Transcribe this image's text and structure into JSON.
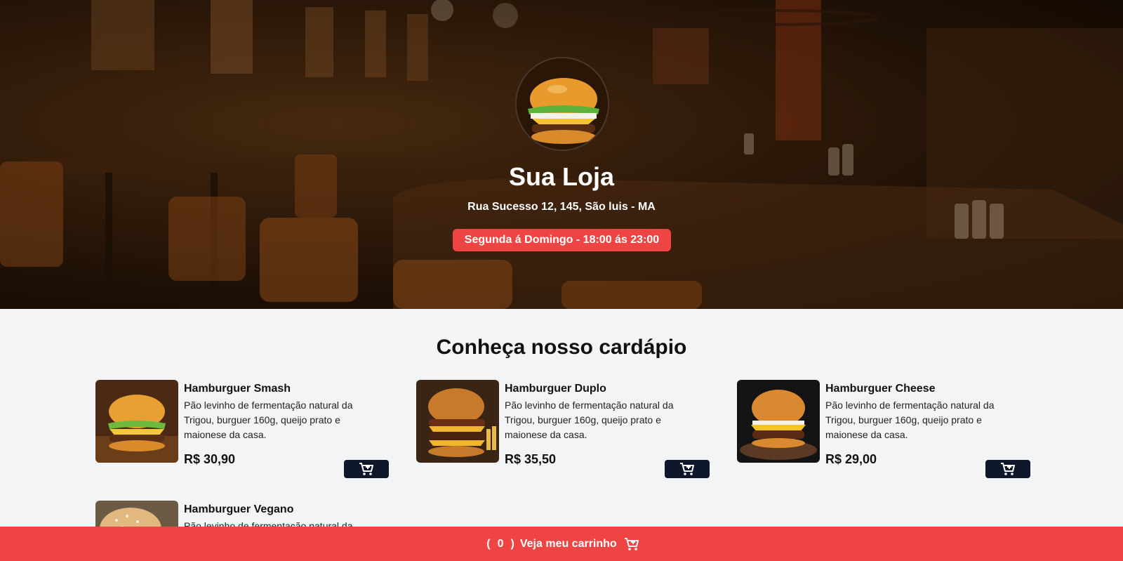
{
  "hero": {
    "store_name": "Sua Loja",
    "address": "Rua Sucesso 12, 145, São luis - MA",
    "hours": "Segunda á Domingo - 18:00 ás 23:00",
    "logo_icon": "burger-logo-icon"
  },
  "menu": {
    "title": "Conheça nosso cardápio",
    "products": [
      {
        "name": "Hamburguer Smash",
        "description": "Pão levinho de fermentação natural da Trigou, burguer 160g, queijo prato e maionese da casa.",
        "price": "R$ 30,90",
        "icon": "burger-smash-image"
      },
      {
        "name": "Hamburguer Duplo",
        "description": "Pão levinho de fermentação natural da Trigou, burguer 160g, queijo prato e maionese da casa.",
        "price": "R$ 35,50",
        "icon": "burger-duplo-image"
      },
      {
        "name": "Hamburguer Cheese",
        "description": "Pão levinho de fermentação natural da Trigou, burguer 160g, queijo prato e maionese da casa.",
        "price": "R$ 29,00",
        "icon": "burger-cheese-image"
      },
      {
        "name": "Hamburguer Vegano",
        "description": "Pão levinho de fermentação natural da",
        "price": "",
        "icon": "burger-vegano-image"
      }
    ],
    "add_button_icon": "add-to-cart-icon"
  },
  "cart": {
    "open_paren": "(",
    "count": "0",
    "close_paren": ")",
    "label": "Veja meu carrinho",
    "icon": "cart-icon"
  },
  "colors": {
    "accent_red": "#ef4444",
    "dark_button": "#0f172a",
    "background": "#f3f4f6"
  }
}
